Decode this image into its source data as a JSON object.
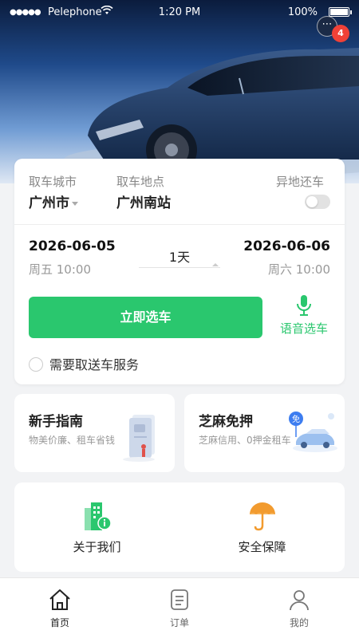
{
  "status_bar": {
    "carrier": "Pelephone",
    "time": "1:20 PM",
    "battery": "100%"
  },
  "message_badge": "4",
  "booking": {
    "pickup_city_label": "取车城市",
    "pickup_city": "广州市",
    "pickup_location_label": "取车地点",
    "pickup_location": "广州南站",
    "return_other_label": "异地还车",
    "return_other_enabled": false,
    "start_date": "2026-06-05",
    "start_time": "周五 10:00",
    "duration": "1天",
    "end_date": "2026-06-06",
    "end_time": "周六 10:00",
    "select_button": "立即选车",
    "voice_button": "语音选车",
    "delivery_label": "需要取送车服务"
  },
  "features": [
    {
      "title": "新手指南",
      "desc": "物美价廉、租车省钱"
    },
    {
      "title": "芝麻免押",
      "desc": "芝麻信用、0押金租车",
      "badge": "免"
    }
  ],
  "links": [
    {
      "label": "关于我们",
      "icon": "building-info-icon"
    },
    {
      "label": "安全保障",
      "icon": "umbrella-icon"
    }
  ],
  "tabs": [
    {
      "label": "首页",
      "icon": "home-icon",
      "active": true
    },
    {
      "label": "订单",
      "icon": "order-list-icon",
      "active": false
    },
    {
      "label": "我的",
      "icon": "profile-icon",
      "active": false
    }
  ],
  "colors": {
    "primary": "#2ac76e",
    "badge": "#f04137",
    "orange": "#f29b2f"
  }
}
